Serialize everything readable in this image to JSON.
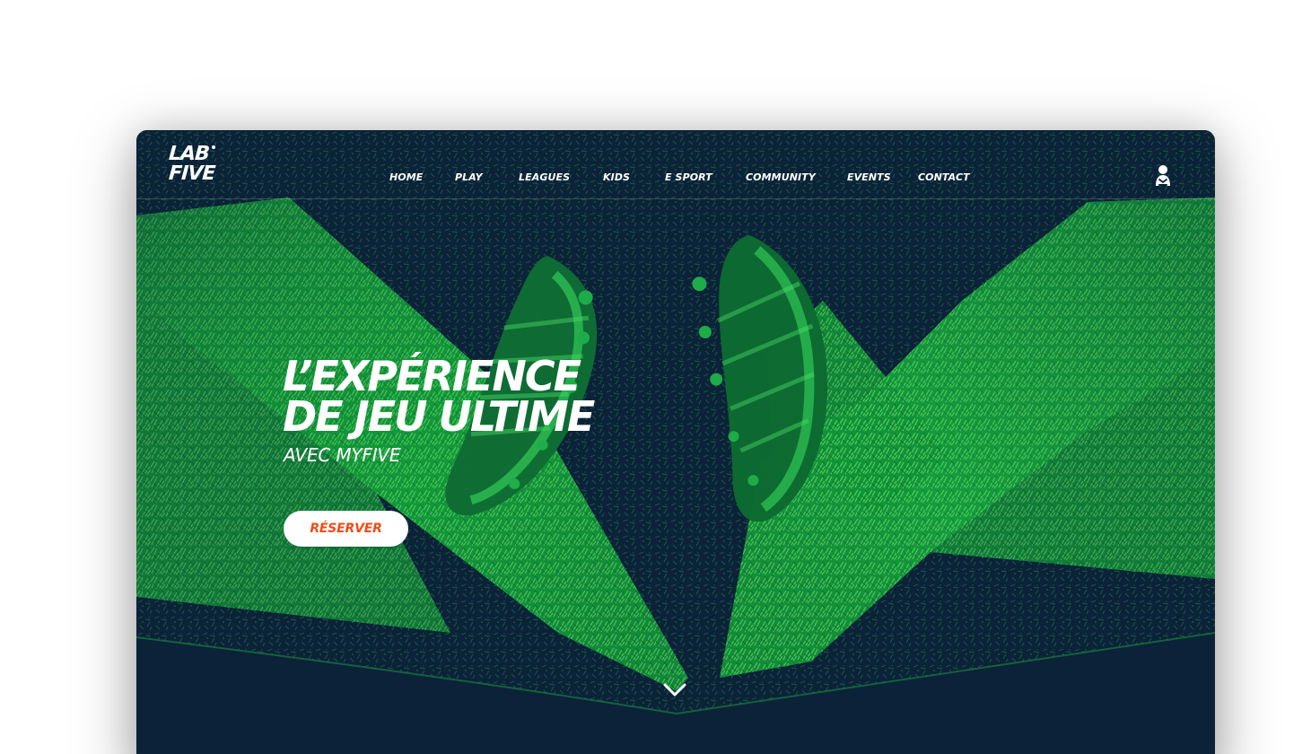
{
  "site": {
    "logo_line1": "LAB",
    "logo_line2": "FIVE"
  },
  "navigation": {
    "items": [
      {
        "label": "HOME"
      },
      {
        "label": "PLAY"
      },
      {
        "label": "LEAGUES"
      },
      {
        "label": "KIDS"
      },
      {
        "label": "E SPORT"
      },
      {
        "label": "COMMUNITY"
      },
      {
        "label": "EVENTS"
      },
      {
        "label": "CONTACT"
      }
    ]
  },
  "hero": {
    "headline_line1": "L’EXPÉRIENCE",
    "headline_line2": "DE JEU ULTIME",
    "subline": "AVEC MYFIVE",
    "cta_label": "RÉSERVER"
  },
  "icons": {
    "account": "user-profile-icon",
    "scroll": "chevron-down-icon"
  },
  "colors": {
    "background": "#0b2238",
    "grass": "#19a33d",
    "grass_light": "#42cf58",
    "cta_text": "#ef4c16",
    "white": "#ffffff"
  }
}
